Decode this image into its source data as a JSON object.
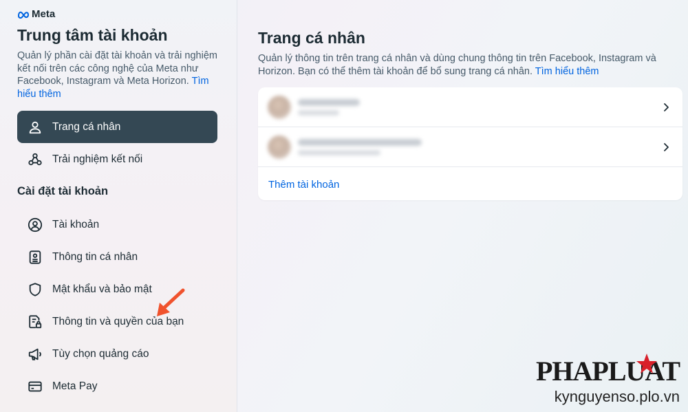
{
  "brand": {
    "name": "Meta"
  },
  "sidebar": {
    "title": "Trung tâm tài khoản",
    "description": "Quản lý phần cài đặt tài khoản và trải nghiệm kết nối trên các công nghệ của Meta như Facebook, Instagram và Meta Horizon.",
    "learn_more": "Tìm hiểu thêm",
    "top_items": [
      {
        "label": "Trang cá nhân",
        "icon": "person-icon",
        "active": true
      },
      {
        "label": "Trải nghiệm kết nối",
        "icon": "connected-nodes-icon",
        "active": false
      }
    ],
    "section_heading": "Cài đặt tài khoản",
    "settings_items": [
      {
        "label": "Tài khoản",
        "icon": "account-circle-icon"
      },
      {
        "label": "Thông tin cá nhân",
        "icon": "id-card-icon"
      },
      {
        "label": "Mật khẩu và bảo mật",
        "icon": "shield-icon"
      },
      {
        "label": "Thông tin và quyền của bạn",
        "icon": "document-lock-icon"
      },
      {
        "label": "Tùy chọn quảng cáo",
        "icon": "megaphone-icon"
      },
      {
        "label": "Meta Pay",
        "icon": "credit-card-icon"
      }
    ]
  },
  "main": {
    "title": "Trang cá nhân",
    "description": "Quản lý thông tin trên trang cá nhân và dùng chung thông tin trên Facebook, Instagram và Horizon. Bạn có thể thêm tài khoản để bổ sung trang cá nhân.",
    "learn_more": "Tìm hiểu thêm",
    "add_account": "Thêm tài khoản"
  },
  "watermark": {
    "logo": "PHAPLUAT",
    "url": "kynguyenso.plo.vn"
  },
  "colors": {
    "accent": "#0064e0",
    "active_nav_bg": "#344854",
    "text_primary": "#1c2b33",
    "text_secondary": "#465a69",
    "annotation_arrow": "#f0522d"
  }
}
